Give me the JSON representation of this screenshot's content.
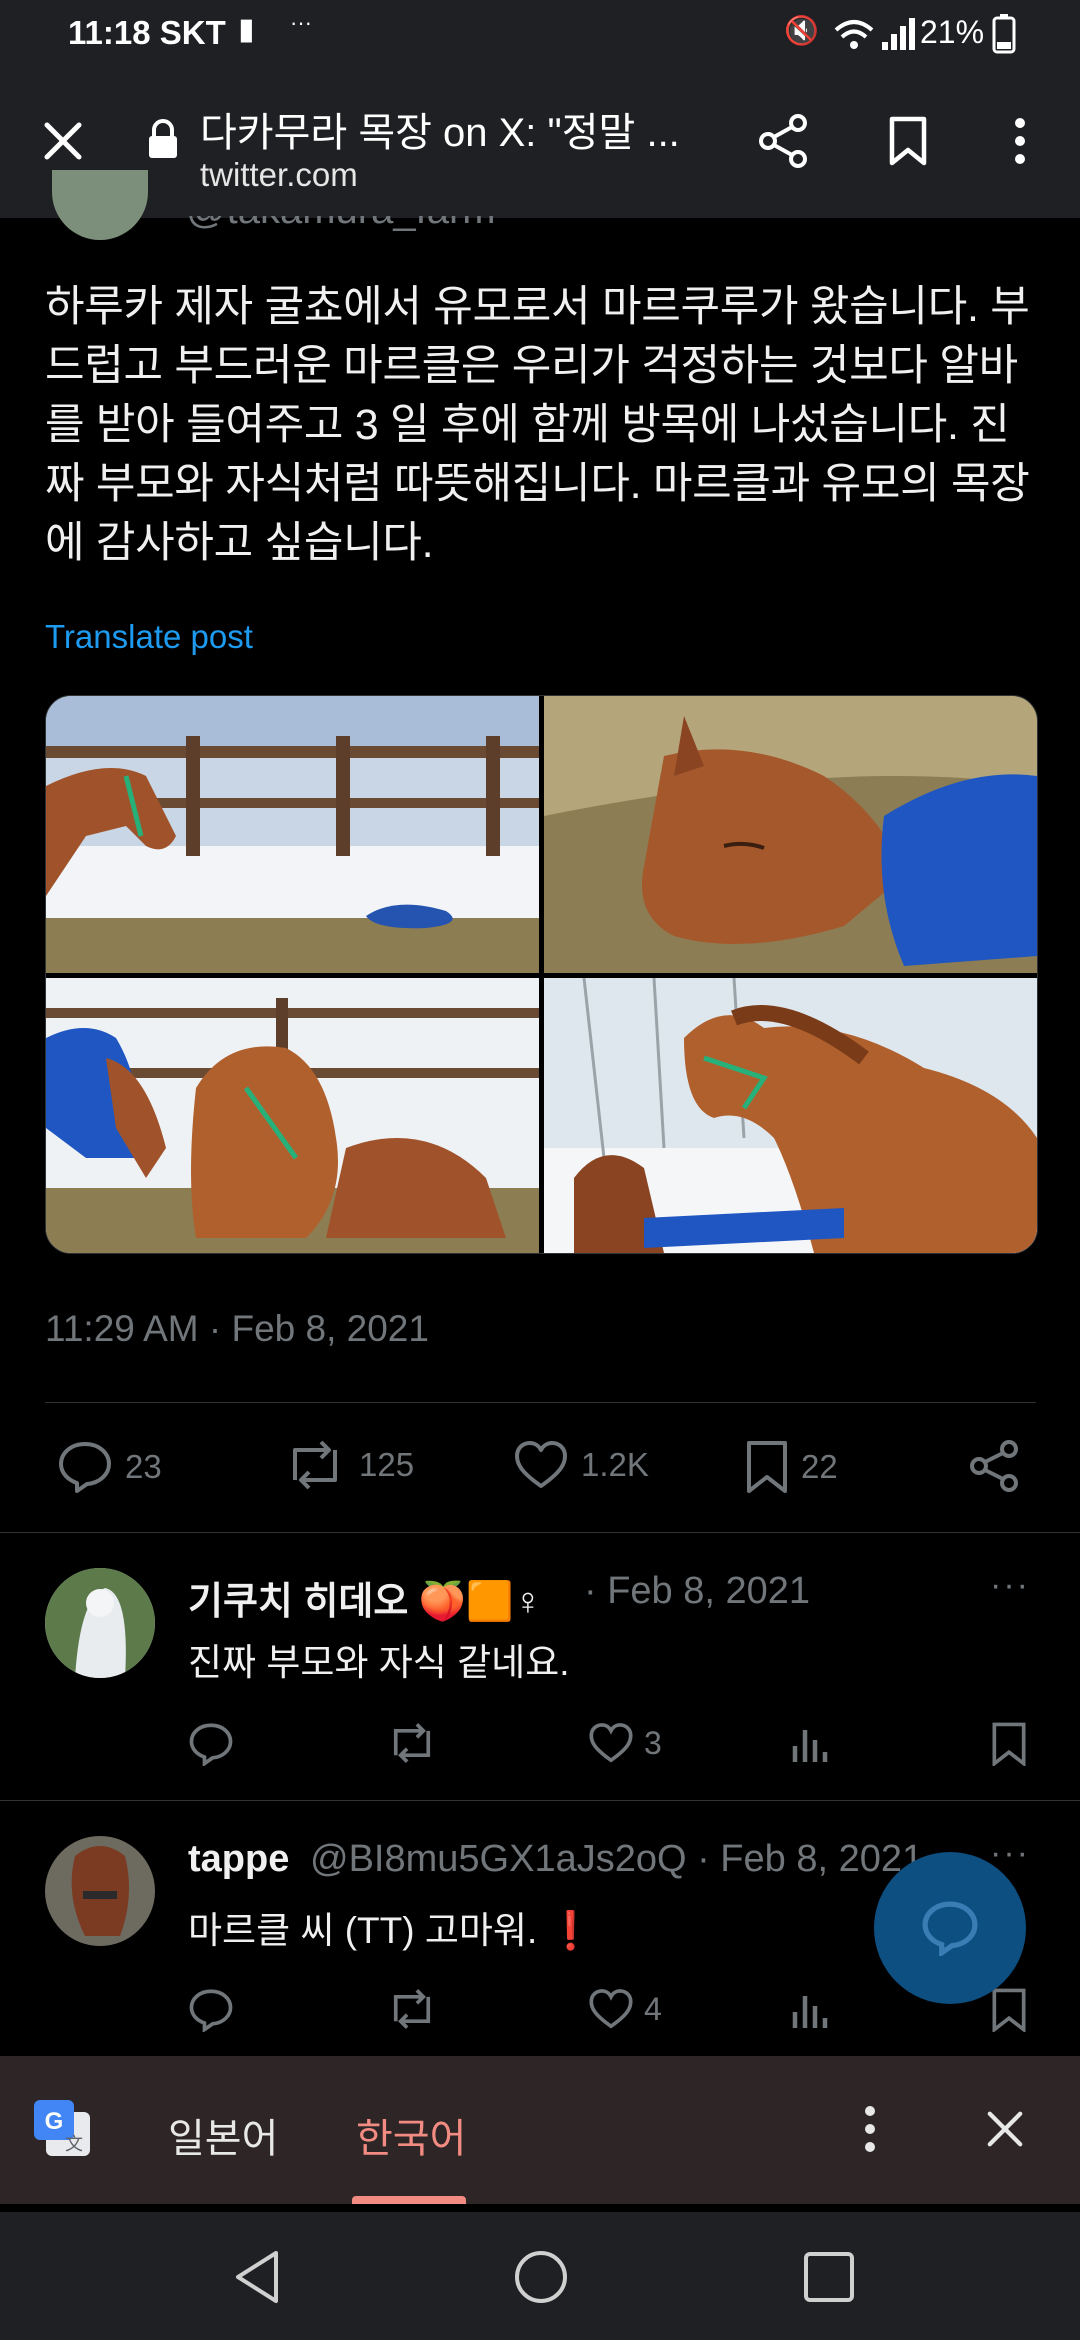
{
  "status_bar": {
    "time": "11:18",
    "carrier": "SKT",
    "battery": "21%"
  },
  "browser": {
    "title": "다카무라 목장 on X: \"정말 ...",
    "domain": "twitter.com"
  },
  "post": {
    "handle_partial": "@takamura_farm",
    "text": "하루카 제자 굴쵸에서 유모로서 마르쿠루가 왔습니다. 부드럽고 부드러운 마르클은 우리가 걱정하는 것보다 알바를 받아 들여주고 3 일 후에 함께 방목에 나섰습니다. 진짜 부모와 자식처럼 따뜻해집니다. 마르클과 유모의 목장에 감사하고 싶습니다.",
    "translate_label": "Translate post",
    "timestamp": "11:29 AM · Feb 8, 2021",
    "stats": {
      "replies": "23",
      "reposts": "125",
      "likes": "1.2K",
      "bookmarks": "22"
    }
  },
  "replies": [
    {
      "name": "기쿠치 히데오 🍑🟧♀",
      "meta": "· Feb 8, 2021",
      "text": "진짜 부모와 자식 같네요.",
      "likes": "3",
      "more": "···"
    },
    {
      "name": "tappe",
      "meta": "@BI8mu5GX1aJs2oQ · Feb 8, 2021",
      "text": "마르클 씨 (TT) 고마워. ❗",
      "likes": "4",
      "more": "···"
    }
  ],
  "translate_bar": {
    "source_lang": "일본어",
    "target_lang": "한국어"
  },
  "colors": {
    "accent_blue": "#1d9bf0",
    "muted": "#71767b",
    "active_lang": "#f28b82",
    "fab": "#0d4f80"
  }
}
